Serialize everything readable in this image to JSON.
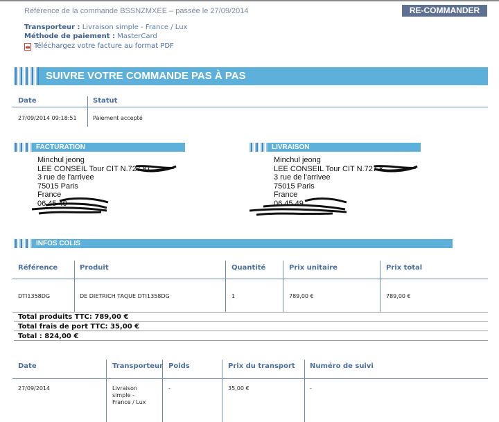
{
  "header": {
    "order_ref": "Référence de la commande BSSNZMXEE – passée le 27/09/2014",
    "recommand_button": "RE-COMMANDER",
    "carrier_label": "Transporteur :",
    "carrier_value": "Livraison simple - France / Lux",
    "payment_label": "Méthode de paiement :",
    "payment_value": "MasterCard",
    "invoice_link": "Téléchargez votre facture au format PDF"
  },
  "tracking": {
    "title": "SUIVRE VOTRE COMMANDE PAS À PAS",
    "col_date": "Date",
    "col_status": "Statut",
    "row_date": "27/09/2014 09:18:51",
    "row_status": "Paiement accepté"
  },
  "billing": {
    "title": "FACTURATION",
    "lines": [
      "Minchul jeong",
      "LEE CONSEIL Tour CIT N.727 KC",
      "3 rue de l'arrivee",
      "75015 Paris",
      "France",
      "06 45 49"
    ]
  },
  "shipping": {
    "title": "LIVRAISON",
    "lines": [
      "Minchul jeong",
      "LEE CONSEIL Tour CIT N.727 K",
      "3 rue de l'arrivee",
      "75015 Paris",
      "France",
      "06 45 49"
    ]
  },
  "package": {
    "title": "INFOS COLIS",
    "headers": [
      "Référence",
      "Produit",
      "Quantité",
      "Prix unitaire",
      "Prix total"
    ],
    "row": [
      "DTI1358DG",
      "DE DIETRICH TAQUE DTI1358DG",
      "1",
      "789,00 €",
      "789,00 €"
    ],
    "total_products": "Total produits TTC: 789,00 €",
    "total_shipping": "Total frais de port TTC: 35,00 €",
    "total": "Total : 824,00 €"
  },
  "delivery": {
    "headers": [
      "Date",
      "Transporteur",
      "Poids",
      "Prix du transport",
      "Numéro de suivi"
    ],
    "row_date": "27/09/2014",
    "row_carrier": [
      "Livraison",
      "simple -",
      "France / Lux"
    ],
    "row_weight": "-",
    "row_price": "35,00 €",
    "row_tracking": "-"
  },
  "colors": {
    "accent_bar": "#5cb0d9",
    "header_text": "#4b6f9e",
    "button_bg": "#5e7192"
  }
}
